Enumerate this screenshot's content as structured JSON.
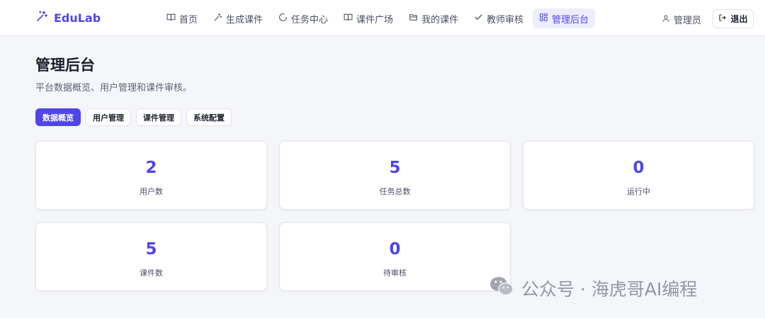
{
  "brand": {
    "name": "EduLab"
  },
  "nav": {
    "items": [
      {
        "label": "首页",
        "icon": "book-icon"
      },
      {
        "label": "生成课件",
        "icon": "magic-wand-icon"
      },
      {
        "label": "任务中心",
        "icon": "loader-icon"
      },
      {
        "label": "课件广场",
        "icon": "book-open-icon"
      },
      {
        "label": "我的课件",
        "icon": "folder-icon"
      },
      {
        "label": "教师审核",
        "icon": "check-icon"
      },
      {
        "label": "管理后台",
        "icon": "dashboard-icon",
        "active": true
      }
    ]
  },
  "user": {
    "name": "管理员",
    "icon": "user-icon"
  },
  "logout": {
    "label": "退出",
    "icon": "logout-icon"
  },
  "page": {
    "title": "管理后台",
    "subtitle": "平台数据概览、用户管理和课件审核。"
  },
  "tabs": [
    {
      "label": "数据概览",
      "active": true
    },
    {
      "label": "用户管理"
    },
    {
      "label": "课件管理"
    },
    {
      "label": "系统配置"
    }
  ],
  "stats": [
    {
      "value": "2",
      "label": "用户数"
    },
    {
      "value": "5",
      "label": "任务总数"
    },
    {
      "value": "0",
      "label": "运行中"
    },
    {
      "value": "5",
      "label": "课件数"
    },
    {
      "value": "0",
      "label": "待审核"
    }
  ],
  "watermark": {
    "text": "公众号 · 海虎哥AI编程",
    "icon": "wechat-icon"
  },
  "colors": {
    "accent": "#4f46e5",
    "background": "#f5f6fa"
  }
}
